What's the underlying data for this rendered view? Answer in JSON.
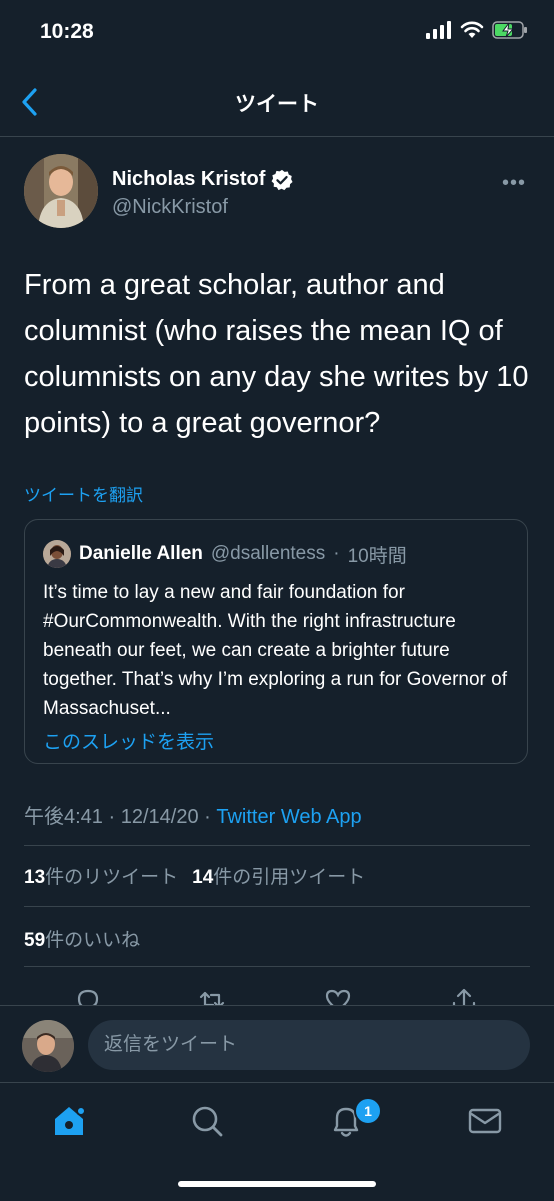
{
  "status_bar": {
    "time": "10:28"
  },
  "nav": {
    "title": "ツイート"
  },
  "author": {
    "name": "Nicholas Kristof",
    "handle": "@NickKristof",
    "verified": true
  },
  "tweet": {
    "text": "From a great scholar, author and columnist (who raises the mean IQ of columnists on any day she writes by 10 points) to a great governor?",
    "translate_label": "ツイートを翻訳"
  },
  "quote": {
    "name": "Danielle Allen",
    "handle": "@dsallentess",
    "time": "10時間",
    "text": "It’s time to lay a new and fair foundation for #OurCommonwealth. With the right infrastructure beneath our feet, we can create a brighter future together. That’s why I’m exploring a run for Governor of Massachuset...",
    "show_thread": "このスレッドを表示"
  },
  "meta": {
    "time": "午後4:41",
    "date": "12/14/20",
    "source": "Twitter Web App"
  },
  "stats": {
    "retweets_count": "13",
    "retweets_label": "件のリツイート",
    "quotes_count": "14",
    "quotes_label": "件の引用ツイート",
    "likes_count": "59",
    "likes_label": "件のいいね"
  },
  "reply": {
    "placeholder": "返信をツイート"
  },
  "tabbar": {
    "notifications_badge": "1"
  },
  "colors": {
    "background": "#15202b",
    "accent": "#1da1f2",
    "secondary_text": "#8899a6",
    "border": "#38444d"
  },
  "icons": [
    "back-chevron-icon",
    "verified-badge-icon",
    "more-icon",
    "reply-icon",
    "retweet-icon",
    "like-icon",
    "share-icon",
    "home-icon",
    "search-icon",
    "notifications-icon",
    "messages-icon"
  ]
}
